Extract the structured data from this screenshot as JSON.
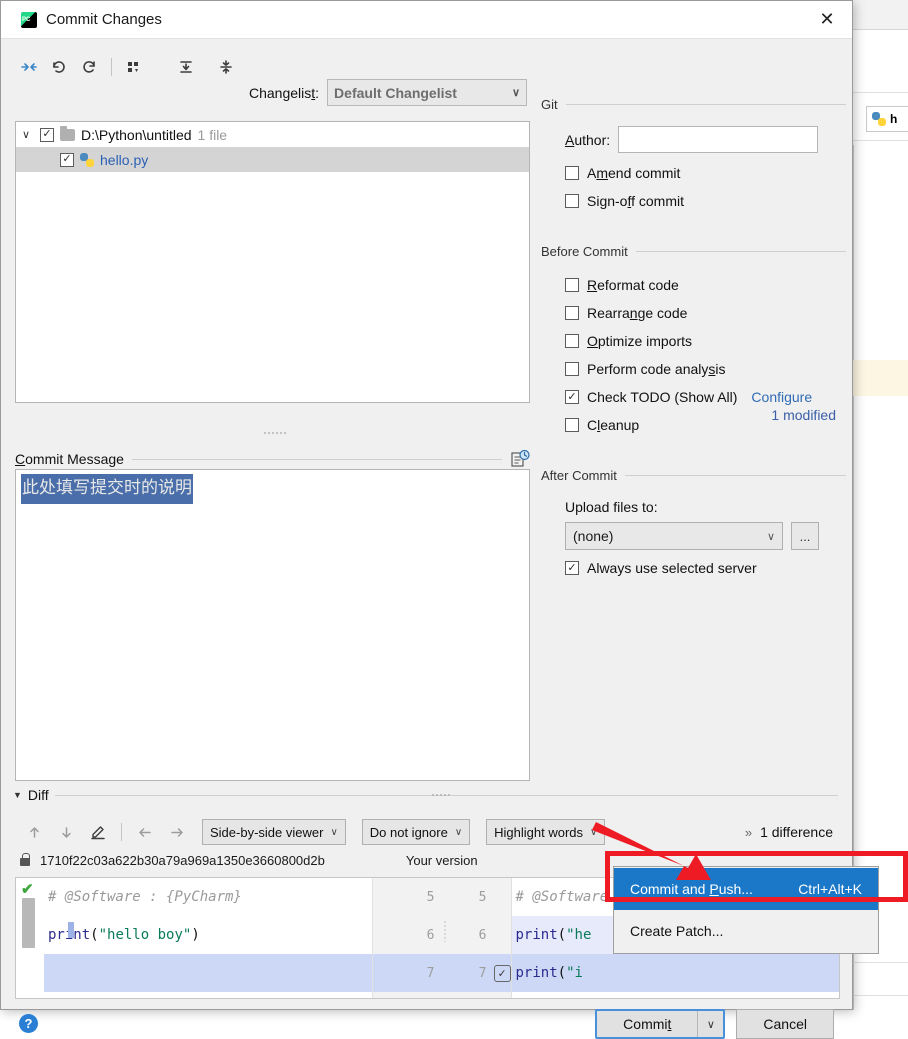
{
  "window": {
    "title": "Commit Changes",
    "app_icon": "pycharm-icon",
    "close_label": "✕"
  },
  "toolbar": {
    "items": [
      {
        "name": "show-diff-icon",
        "glyph": "⇥"
      },
      {
        "name": "rollback-icon",
        "glyph": "↶"
      },
      {
        "name": "refresh-icon",
        "glyph": "↻"
      },
      {
        "name": "group-by-icon",
        "glyph": "☰"
      },
      {
        "name": "expand-all-icon",
        "glyph": "⤓"
      },
      {
        "name": "collapse-all-icon",
        "glyph": "⤑"
      }
    ],
    "changelist_label_pre": "Changelist",
    "changelist_label_mnemonic": ":",
    "changelist_value": "Default Changelist",
    "chevron": "∨"
  },
  "file_tree": {
    "root": {
      "twisty": "∨",
      "checked": true,
      "check_glyph": "✓",
      "path": "D:\\Python\\untitled",
      "count": "1 file"
    },
    "files": [
      {
        "checked": true,
        "check_glyph": "✓",
        "name": "hello.py",
        "icon": "python-file-icon"
      }
    ],
    "status": "1 modified"
  },
  "commit_message": {
    "label_mnemonic": "C",
    "label_rest": "ommit Message",
    "history_icon": "commit-history-icon",
    "value": "此处填写提交时的说明",
    "selected": true
  },
  "git_section": {
    "title": "Git",
    "author_label_mnemonic": "A",
    "author_label_rest": "uthor:",
    "author_value": "",
    "checkboxes": [
      {
        "name": "amend-commit",
        "mnemonic_pre": "A",
        "mnemonic": "m",
        "rest": "end commit",
        "checked": false
      },
      {
        "name": "sign-off-commit",
        "mnemonic_pre": "Sign-o",
        "mnemonic": "f",
        "rest": "f commit",
        "checked": false
      }
    ]
  },
  "before_commit": {
    "title": "Before Commit",
    "checkboxes": [
      {
        "name": "reformat-code",
        "mnemonic_pre": "",
        "mnemonic": "R",
        "rest": "eformat code",
        "checked": false
      },
      {
        "name": "rearrange-code",
        "mnemonic_pre": "Rearra",
        "mnemonic": "n",
        "rest": "ge code",
        "checked": false
      },
      {
        "name": "optimize-imports",
        "mnemonic_pre": "",
        "mnemonic": "O",
        "rest": "ptimize imports",
        "checked": false
      },
      {
        "name": "perform-code-analysis",
        "mnemonic_pre": "Perform code analy",
        "mnemonic": "s",
        "rest": "is",
        "checked": false
      },
      {
        "name": "check-todo",
        "mnemonic_pre": "Check TODO (Show All)",
        "mnemonic": "",
        "rest": "",
        "checked": true,
        "link": "Configure"
      },
      {
        "name": "cleanup",
        "mnemonic_pre": "C",
        "mnemonic": "l",
        "rest": "eanup",
        "checked": false
      }
    ]
  },
  "after_commit": {
    "title": "After Commit",
    "upload_label": "Upload files to:",
    "upload_value": "(none)",
    "upload_chevron": "∨",
    "browse_label": "...",
    "always_use": {
      "label": "Always use selected server",
      "checked": true,
      "check_glyph": "✓"
    }
  },
  "diff": {
    "section_arrow": "▼",
    "section_label": "Diff",
    "toolbar_icons": [
      {
        "name": "previous-difference-icon",
        "glyph": "↑"
      },
      {
        "name": "next-difference-icon",
        "glyph": "↓"
      },
      {
        "name": "edit-source-icon",
        "glyph": "✎"
      },
      {
        "name": "apply-left-icon",
        "glyph": "←"
      },
      {
        "name": "apply-right-icon",
        "glyph": "→"
      }
    ],
    "viewer_mode": "Side-by-side viewer",
    "ignore_mode": "Do not ignore",
    "highlight_mode": "Highlight words",
    "more_glyph": "»",
    "difference_count": "1 difference",
    "left_version_hash": "1710f22c03a622b30a79a969a1350e3660800d2b",
    "right_version_label": "Your version",
    "left_lines": [
      {
        "type": "comment",
        "text": "# @Software : {PyCharm}"
      },
      {
        "type": "code",
        "prefix": "print",
        "paren_open": "(",
        "string": "\"hello boy\"",
        "paren_close": ")"
      },
      {
        "type": "empty",
        "text": ""
      }
    ],
    "right_lines": [
      {
        "type": "comment",
        "text": "# @Software : {PyCharm}"
      },
      {
        "type": "code",
        "prefix": "print",
        "paren_open": "(",
        "string": "\"he",
        "paren_close": ""
      },
      {
        "type": "code",
        "prefix": "print",
        "paren_open": "(",
        "string": "\"i ",
        "paren_close": ""
      }
    ],
    "line_numbers_left": [
      "5",
      "6",
      "7"
    ],
    "line_numbers_right": [
      "5",
      "6",
      "7"
    ],
    "accept_glyph": "✓",
    "ok_marker": "✔"
  },
  "context_menu": {
    "items": [
      {
        "name": "commit-and-push",
        "label_pre": "Commit and ",
        "mnemonic": "P",
        "label_rest": "ush...",
        "shortcut": "Ctrl+Alt+K",
        "highlighted": true
      },
      {
        "name": "create-patch",
        "label_pre": "Create Patch...",
        "mnemonic": "",
        "label_rest": "",
        "shortcut": "",
        "highlighted": false
      }
    ]
  },
  "footer": {
    "help_glyph": "?",
    "commit_label_pre": "Commi",
    "commit_mnemonic": "t",
    "commit_chevron": "∨",
    "cancel_label": "Cancel"
  },
  "background": {
    "tab_label": "h",
    "tab_icon": "python-file-icon"
  },
  "colors": {
    "accent_blue": "#2b5fb5",
    "selection_blue": "#4a6ea9",
    "menu_highlight": "#1b78c8",
    "annotation_red": "#ee1b24",
    "link_blue": "#2f6cb5",
    "diff_added": "#ccd8f5"
  }
}
